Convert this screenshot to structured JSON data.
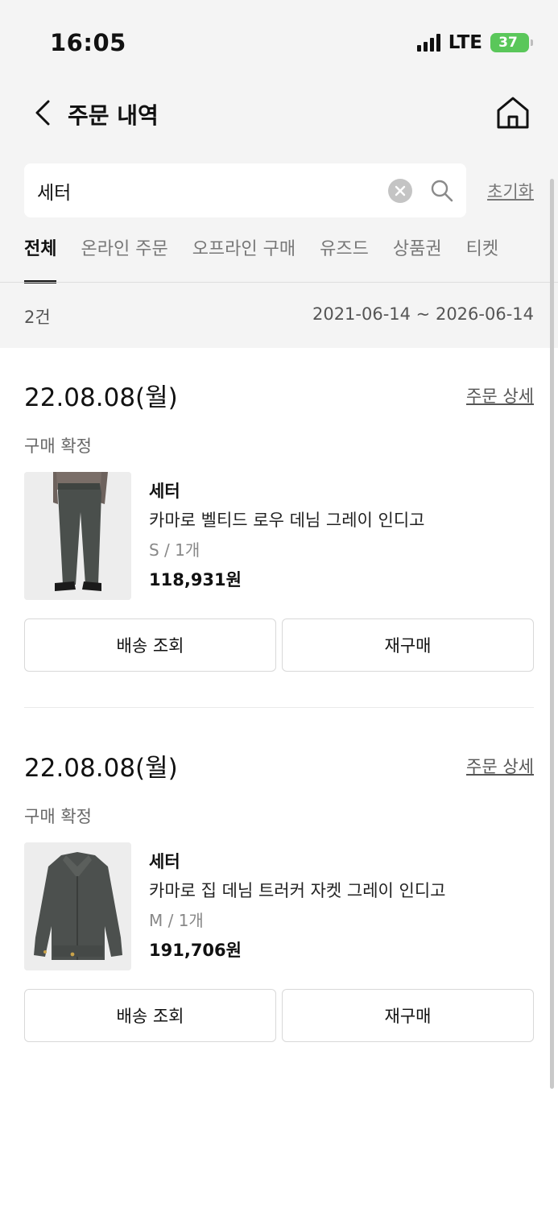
{
  "status_bar": {
    "time": "16:05",
    "network": "LTE",
    "battery": "37"
  },
  "header": {
    "title": "주문 내역"
  },
  "search": {
    "value": "세터",
    "reset_label": "초기화"
  },
  "tabs": [
    {
      "label": "전체",
      "active": true
    },
    {
      "label": "온라인 주문",
      "active": false
    },
    {
      "label": "오프라인 구매",
      "active": false
    },
    {
      "label": "유즈드",
      "active": false
    },
    {
      "label": "상품권",
      "active": false
    },
    {
      "label": "티켓",
      "active": false
    }
  ],
  "summary": {
    "count": "2건",
    "date_range": "2021-06-14 ~ 2026-06-14"
  },
  "orders": [
    {
      "date": "22.08.08(월)",
      "detail_label": "주문 상세",
      "status": "구매 확정",
      "brand": "세터",
      "name": "카마로 벨티드 로우 데님 그레이 인디고",
      "option": "S / 1개",
      "price": "118,931원",
      "track_label": "배송 조회",
      "rebuy_label": "재구매"
    },
    {
      "date": "22.08.08(월)",
      "detail_label": "주문 상세",
      "status": "구매 확정",
      "brand": "세터",
      "name": "카마로 집 데님 트러커 자켓 그레이 인디고",
      "option": "M / 1개",
      "price": "191,706원",
      "track_label": "배송 조회",
      "rebuy_label": "재구매"
    }
  ]
}
